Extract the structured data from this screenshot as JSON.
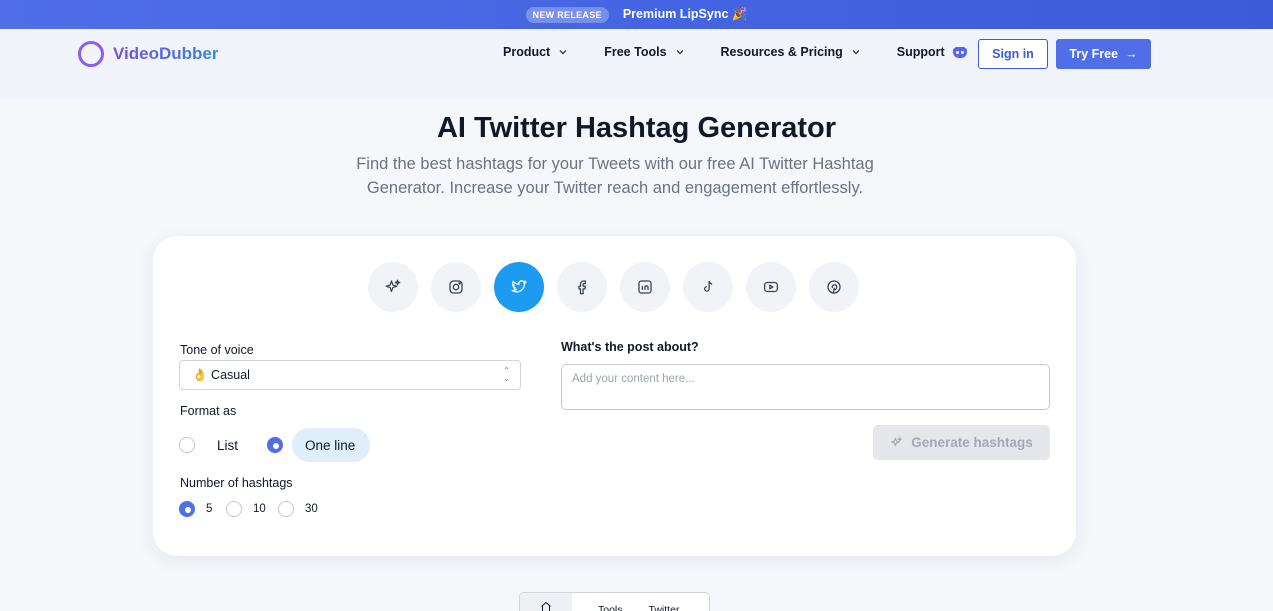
{
  "announcement": {
    "badge": "NEW RELEASE",
    "text": "Premium LipSync 🎉"
  },
  "header": {
    "logo_text": "VideoDubber",
    "nav": [
      {
        "label": "Product"
      },
      {
        "label": "Free Tools"
      },
      {
        "label": "Resources & Pricing"
      },
      {
        "label": "Support"
      }
    ],
    "sign_in": "Sign in",
    "try_free": "Try Free",
    "try_free_arrow": "→"
  },
  "hero": {
    "title": "AI Twitter Hashtag Generator",
    "subtitle": "Find the best hashtags for your Tweets with our free AI Twitter Hashtag Generator. Increase your Twitter reach and engagement effortlessly."
  },
  "platforms": [
    {
      "icon": "sparkles-icon",
      "active": false
    },
    {
      "icon": "instagram-icon",
      "active": false
    },
    {
      "icon": "twitter-icon",
      "active": true
    },
    {
      "icon": "facebook-icon",
      "active": false
    },
    {
      "icon": "linkedin-icon",
      "active": false
    },
    {
      "icon": "tiktok-icon",
      "active": false
    },
    {
      "icon": "youtube-icon",
      "active": false
    },
    {
      "icon": "pinterest-icon",
      "active": false
    }
  ],
  "form": {
    "tone_label": "Tone of voice",
    "tone_value": "👌 Casual",
    "format_label": "Format as",
    "format_options": [
      "List",
      "One line"
    ],
    "format_selected": "One line",
    "count_label": "Number of hashtags",
    "count_options": [
      "5",
      "10",
      "30"
    ],
    "count_selected": "5",
    "post_label": "What's the post about?",
    "post_placeholder": "Add your content here...",
    "post_value": "",
    "generate": "Generate hashtags"
  },
  "breadcrumb": {
    "items": [
      "Tools",
      "Twitter"
    ]
  },
  "colors": {
    "accent": "#4f6ee8",
    "twitter": "#1d9bf0",
    "announce_bg": "#3b5bdb"
  }
}
